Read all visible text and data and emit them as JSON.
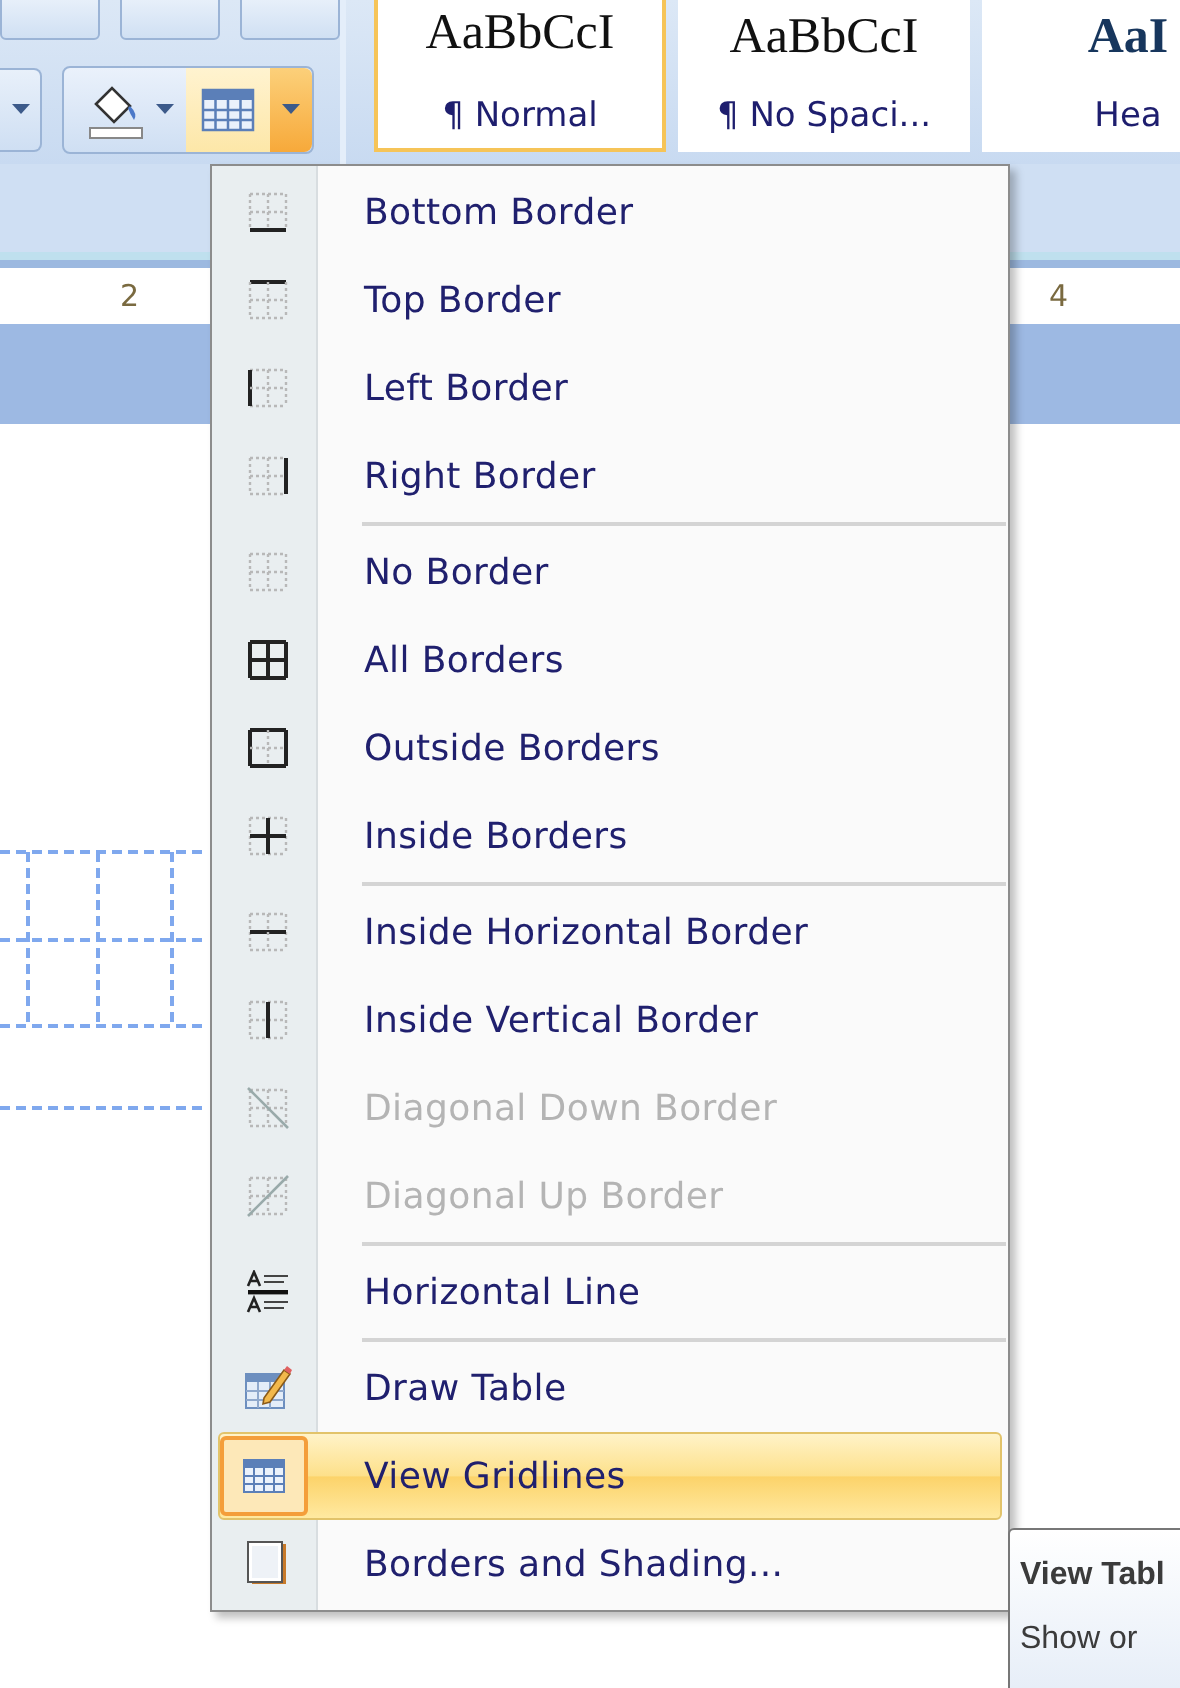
{
  "ribbon": {
    "borders_button": {
      "active": true
    },
    "styles": [
      {
        "sample": "AaBbCcI",
        "name": "¶ Normal",
        "selected": true,
        "kind": "body"
      },
      {
        "sample": "AaBbCcI",
        "name": "¶ No Spaci...",
        "selected": false,
        "kind": "body"
      },
      {
        "sample": "AaI",
        "name": "Hea",
        "selected": false,
        "kind": "heading"
      }
    ]
  },
  "ruler": {
    "labels": [
      "2",
      "4"
    ]
  },
  "borders_menu": {
    "groups": [
      {
        "items": [
          {
            "label": "Bottom Border",
            "kind": "bottom",
            "disabled": false,
            "highlighted": false
          },
          {
            "label": "Top Border",
            "kind": "top",
            "disabled": false,
            "highlighted": false
          },
          {
            "label": "Left Border",
            "kind": "left",
            "disabled": false,
            "highlighted": false
          },
          {
            "label": "Right Border",
            "kind": "right",
            "disabled": false,
            "highlighted": false
          }
        ]
      },
      {
        "items": [
          {
            "label": "No Border",
            "kind": "none",
            "disabled": false,
            "highlighted": false
          },
          {
            "label": "All Borders",
            "kind": "all",
            "disabled": false,
            "highlighted": false
          },
          {
            "label": "Outside Borders",
            "kind": "outside",
            "disabled": false,
            "highlighted": false
          },
          {
            "label": "Inside Borders",
            "kind": "inside",
            "disabled": false,
            "highlighted": false
          }
        ]
      },
      {
        "items": [
          {
            "label": "Inside Horizontal Border",
            "kind": "inside-h",
            "disabled": false,
            "highlighted": false
          },
          {
            "label": "Inside Vertical Border",
            "kind": "inside-v",
            "disabled": false,
            "highlighted": false
          },
          {
            "label": "Diagonal Down Border",
            "kind": "diag-down",
            "disabled": true,
            "highlighted": false
          },
          {
            "label": "Diagonal Up Border",
            "kind": "diag-up",
            "disabled": true,
            "highlighted": false
          }
        ]
      },
      {
        "items": [
          {
            "label": "Horizontal Line",
            "kind": "hline",
            "disabled": false,
            "highlighted": false
          }
        ]
      },
      {
        "items": [
          {
            "label": "Draw Table",
            "kind": "draw",
            "disabled": false,
            "highlighted": false
          },
          {
            "label": "View Gridlines",
            "kind": "grid",
            "disabled": false,
            "highlighted": true
          },
          {
            "label": "Borders and Shading...",
            "kind": "shading",
            "disabled": false,
            "highlighted": false
          }
        ]
      }
    ]
  },
  "tooltip": {
    "title": "View Tabl",
    "text": "Show or"
  }
}
